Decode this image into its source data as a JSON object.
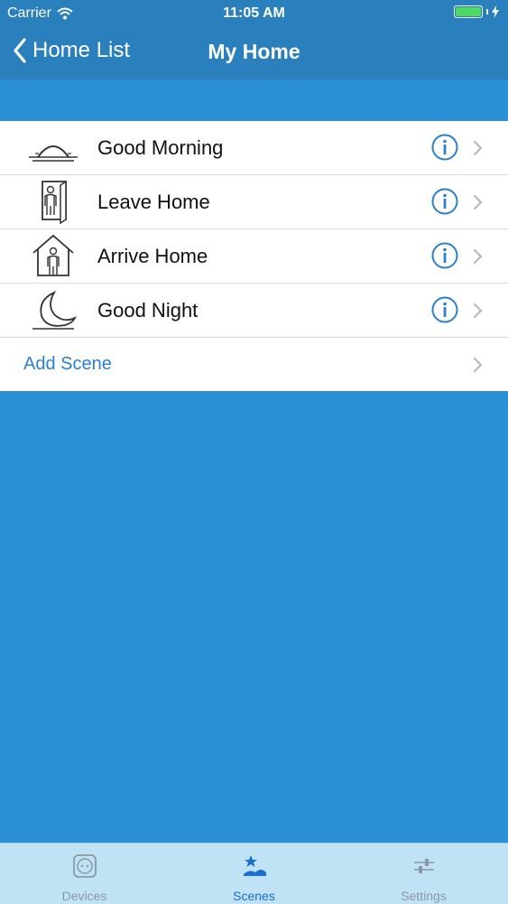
{
  "status_bar": {
    "carrier": "Carrier",
    "time": "11:05 AM"
  },
  "nav": {
    "back_label": "Home List",
    "title": "My Home"
  },
  "scenes": [
    {
      "label": "Good Morning",
      "icon": "sunrise-icon"
    },
    {
      "label": "Leave Home",
      "icon": "leave-home-icon"
    },
    {
      "label": "Arrive Home",
      "icon": "arrive-home-icon"
    },
    {
      "label": "Good Night",
      "icon": "moon-icon"
    }
  ],
  "add_scene_label": "Add Scene",
  "tabs": [
    {
      "label": "Devices",
      "icon": "outlet-icon",
      "active": false
    },
    {
      "label": "Scenes",
      "icon": "scenes-star-icon",
      "active": true
    },
    {
      "label": "Settings",
      "icon": "sliders-icon",
      "active": false
    }
  ],
  "colors": {
    "nav_background": "#2a7fbd",
    "page_background": "#2a8fd4",
    "accent": "#2a7fcf",
    "tabbar_background": "#bfe2f5"
  }
}
